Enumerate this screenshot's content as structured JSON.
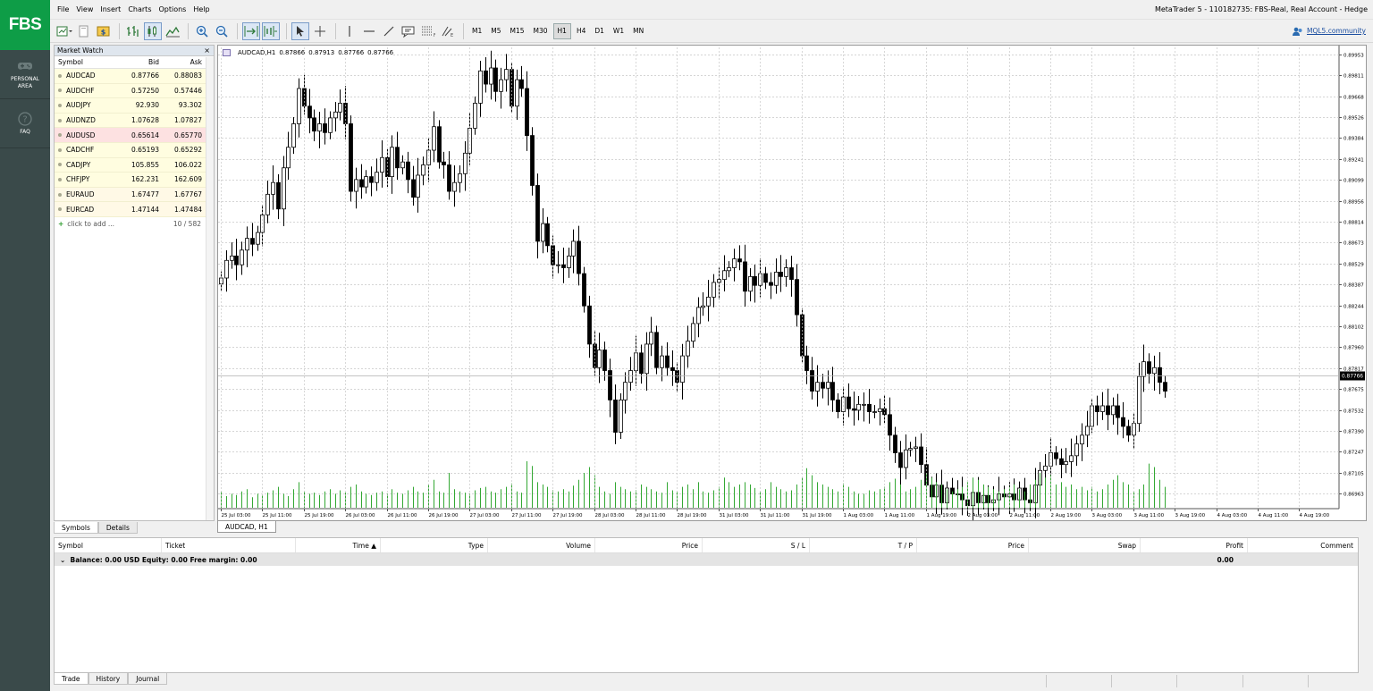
{
  "sidebar": {
    "logo": "FBS",
    "items": [
      {
        "icon": "gamepad-icon",
        "line1": "PERSONAL",
        "line2": "AREA"
      },
      {
        "icon": "question-icon",
        "line1": "FAQ",
        "line2": ""
      }
    ]
  },
  "menu": [
    "File",
    "View",
    "Insert",
    "Charts",
    "Options",
    "Help"
  ],
  "window_title": "MetaTrader 5 - 110182735: FBS-Real, Real Account - Hedge",
  "toolbar": {
    "timeframes": [
      "M1",
      "M5",
      "M15",
      "M30",
      "H1",
      "H4",
      "D1",
      "W1",
      "MN"
    ],
    "active_timeframe": "H1",
    "community_link": "MQL5.community"
  },
  "market_watch": {
    "title": "Market Watch",
    "headers": {
      "symbol": "Symbol",
      "bid": "Bid",
      "ask": "Ask"
    },
    "rows": [
      {
        "symbol": "AUDCAD",
        "bid": "0.87766",
        "ask": "0.88083"
      },
      {
        "symbol": "AUDCHF",
        "bid": "0.57250",
        "ask": "0.57446"
      },
      {
        "symbol": "AUDJPY",
        "bid": "92.930",
        "ask": "93.302"
      },
      {
        "symbol": "AUDNZD",
        "bid": "1.07628",
        "ask": "1.07827"
      },
      {
        "symbol": "AUDUSD",
        "bid": "0.65614",
        "ask": "0.65770"
      },
      {
        "symbol": "CADCHF",
        "bid": "0.65193",
        "ask": "0.65292"
      },
      {
        "symbol": "CADJPY",
        "bid": "105.855",
        "ask": "106.022"
      },
      {
        "symbol": "CHFJPY",
        "bid": "162.231",
        "ask": "162.609"
      },
      {
        "symbol": "EURAUD",
        "bid": "1.67477",
        "ask": "1.67767"
      },
      {
        "symbol": "EURCAD",
        "bid": "1.47144",
        "ask": "1.47484"
      }
    ],
    "add_label": "click to add ...",
    "count": "10 / 582",
    "tabs": [
      "Symbols",
      "Details"
    ]
  },
  "chart": {
    "info": {
      "symbol": "AUDCAD,H1",
      "open": "0.87866",
      "high": "0.87913",
      "low": "0.87766",
      "close": "0.87766"
    },
    "tab_label": "AUDCAD, H1",
    "current_price_label": "0.87766",
    "colors": {
      "bull": "#ffffff",
      "bear": "#000000",
      "volume": "#33a833",
      "grid": "#c8c8c8"
    }
  },
  "chart_data": {
    "type": "candlestick",
    "y_ticks": [
      "0.89953",
      "0.89811",
      "0.89668",
      "0.89526",
      "0.89384",
      "0.89241",
      "0.89099",
      "0.88956",
      "0.88814",
      "0.88673",
      "0.88529",
      "0.88387",
      "0.88244",
      "0.88102",
      "0.87960",
      "0.87817",
      "0.87675",
      "0.87532",
      "0.87390",
      "0.87247",
      "0.87105",
      "0.86963"
    ],
    "ylim": [
      0.8686,
      0.9
    ],
    "x_ticks": [
      "25 Jul 03:00",
      "25 Jul 11:00",
      "25 Jul 19:00",
      "26 Jul 03:00",
      "26 Jul 11:00",
      "26 Jul 19:00",
      "27 Jul 03:00",
      "27 Jul 11:00",
      "27 Jul 19:00",
      "28 Jul 03:00",
      "28 Jul 11:00",
      "28 Jul 19:00",
      "31 Jul 03:00",
      "31 Jul 11:00",
      "31 Jul 19:00",
      "1 Aug 03:00",
      "1 Aug 11:00",
      "1 Aug 19:00",
      "2 Aug 03:00",
      "2 Aug 11:00",
      "2 Aug 19:00",
      "3 Aug 03:00",
      "3 Aug 11:00",
      "3 Aug 19:00",
      "4 Aug 03:00",
      "4 Aug 11:00",
      "4 Aug 19:00"
    ],
    "bars_per_tick": 8,
    "current_price": 0.87766,
    "close": [
      0.8843,
      0.8855,
      0.8858,
      0.8852,
      0.8862,
      0.887,
      0.8866,
      0.8874,
      0.8886,
      0.89,
      0.8908,
      0.889,
      0.8918,
      0.8932,
      0.8948,
      0.8972,
      0.896,
      0.8952,
      0.8943,
      0.8948,
      0.8942,
      0.8952,
      0.8956,
      0.8962,
      0.8948,
      0.8902,
      0.891,
      0.8905,
      0.8912,
      0.8908,
      0.8915,
      0.8925,
      0.8912,
      0.8932,
      0.8918,
      0.8922,
      0.891,
      0.8898,
      0.8913,
      0.892,
      0.893,
      0.8946,
      0.8922,
      0.892,
      0.8902,
      0.8908,
      0.8914,
      0.8928,
      0.8945,
      0.8962,
      0.8984,
      0.8975,
      0.8986,
      0.897,
      0.8978,
      0.8985,
      0.896,
      0.8978,
      0.8972,
      0.894,
      0.8906,
      0.8868,
      0.888,
      0.8865,
      0.8852,
      0.8852,
      0.885,
      0.8858,
      0.8868,
      0.8846,
      0.8824,
      0.8798,
      0.8782,
      0.8794,
      0.878,
      0.876,
      0.8738,
      0.876,
      0.8772,
      0.878,
      0.8792,
      0.8778,
      0.8798,
      0.8806,
      0.8782,
      0.879,
      0.8782,
      0.878,
      0.8772,
      0.879,
      0.88,
      0.8812,
      0.8823,
      0.8824,
      0.883,
      0.884,
      0.8842,
      0.8848,
      0.885,
      0.8856,
      0.8854,
      0.8834,
      0.8844,
      0.8838,
      0.8846,
      0.884,
      0.8838,
      0.8847,
      0.8844,
      0.885,
      0.8842,
      0.8818,
      0.879,
      0.878,
      0.8766,
      0.8772,
      0.8768,
      0.8772,
      0.876,
      0.8752,
      0.8762,
      0.8754,
      0.8753,
      0.8757,
      0.8757,
      0.8752,
      0.8752,
      0.8754,
      0.875,
      0.8736,
      0.8724,
      0.8714,
      0.8726,
      0.8727,
      0.8728,
      0.8716,
      0.8702,
      0.8694,
      0.8702,
      0.869,
      0.87,
      0.8696,
      0.8696,
      0.8692,
      0.8688,
      0.8697,
      0.869,
      0.8695,
      0.869,
      0.8692,
      0.8696,
      0.8694,
      0.8696,
      0.8692,
      0.87,
      0.8692,
      0.869,
      0.8702,
      0.8712,
      0.8715,
      0.8724,
      0.872,
      0.8716,
      0.8718,
      0.8722,
      0.873,
      0.8736,
      0.8742,
      0.8756,
      0.8752,
      0.8756,
      0.875,
      0.8756,
      0.8748,
      0.8742,
      0.8736,
      0.8744,
      0.8776,
      0.8786,
      0.8778,
      0.8782,
      0.8772,
      0.8766
    ]
  },
  "terminal": {
    "headers": [
      "Symbol",
      "Ticket",
      "Time",
      "Type",
      "Volume",
      "Price",
      "S / L",
      "T / P",
      "Price",
      "Swap",
      "Profit",
      "Comment"
    ],
    "balance_line": "Balance: 0.00 USD  Equity: 0.00  Free margin: 0.00",
    "profit": "0.00",
    "tabs": [
      "Trade",
      "History",
      "Journal"
    ]
  }
}
